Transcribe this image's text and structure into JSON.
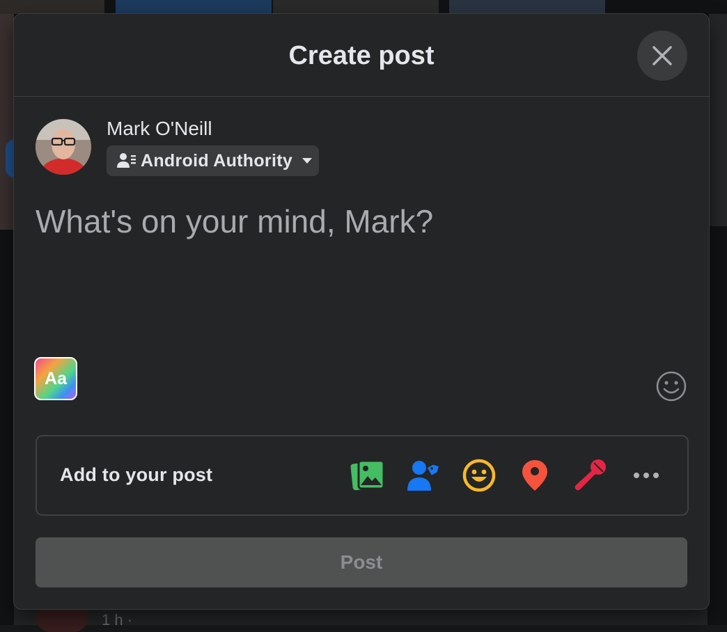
{
  "dialog": {
    "title": "Create post"
  },
  "user": {
    "name": "Mark O'Neill",
    "audience": "Android Authority"
  },
  "composer": {
    "placeholder": "What's on your mind, Mark?",
    "background_picker_label": "Aa"
  },
  "add_to_post": {
    "label": "Add to your post",
    "items": [
      {
        "name": "photo-video-icon",
        "color": "#45bd62"
      },
      {
        "name": "tag-people-icon",
        "color": "#1877f2"
      },
      {
        "name": "feeling-activity-icon",
        "color": "#f7b928"
      },
      {
        "name": "check-in-icon",
        "color": "#f5533d"
      },
      {
        "name": "live-audio-icon",
        "color": "#e42645"
      },
      {
        "name": "more-options-icon",
        "color": "#b0b3b8"
      }
    ]
  },
  "actions": {
    "post_label": "Post"
  },
  "background_page": {
    "timestamp_text": "1 h ·"
  }
}
